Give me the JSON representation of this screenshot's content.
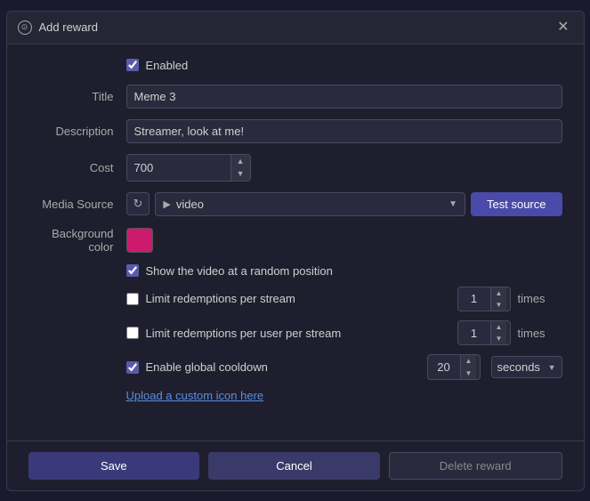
{
  "dialog": {
    "title": "Add reward",
    "close_label": "✕"
  },
  "form": {
    "enabled_label": "Enabled",
    "enabled_checked": true,
    "title_label": "Title",
    "title_value": "Meme 3",
    "description_label": "Description",
    "description_value": "Streamer, look at me!",
    "cost_label": "Cost",
    "cost_value": "700",
    "media_source_label": "Media Source",
    "media_source_value": "video",
    "test_source_label": "Test source",
    "background_color_label": "Background color",
    "background_color_hex": "#cc1a6e",
    "show_random_label": "Show the video at a random position",
    "show_random_checked": true,
    "limit_per_stream_label": "Limit redemptions per stream",
    "limit_per_stream_checked": false,
    "limit_per_stream_value": "1",
    "limit_per_stream_unit": "times",
    "limit_per_user_label": "Limit redemptions per user per stream",
    "limit_per_user_checked": false,
    "limit_per_user_value": "1",
    "limit_per_user_unit": "times",
    "cooldown_label": "Enable global cooldown",
    "cooldown_checked": true,
    "cooldown_value": "20",
    "cooldown_unit": "seconds",
    "upload_link_label": "Upload a custom icon here"
  },
  "footer": {
    "save_label": "Save",
    "cancel_label": "Cancel",
    "delete_label": "Delete reward"
  },
  "icons": {
    "title_icon": "⊙",
    "play_icon": "▶",
    "refresh_icon": "↻",
    "chevron_up": "▲",
    "chevron_down": "▼",
    "select_arrow": "▼"
  }
}
